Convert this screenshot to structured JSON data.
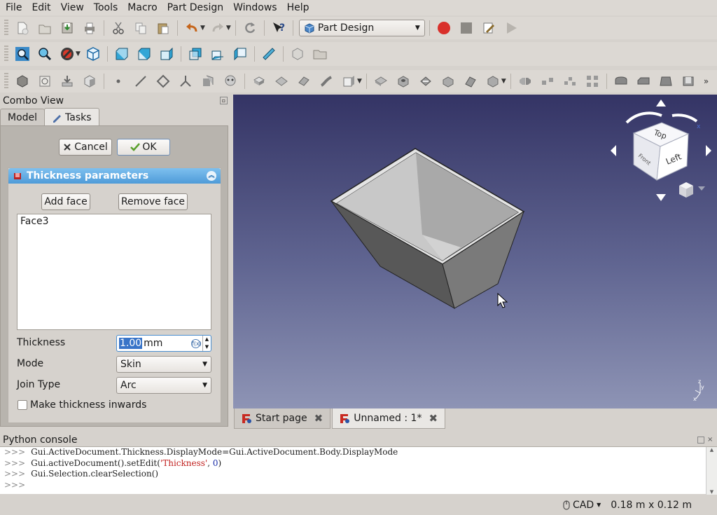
{
  "menubar": {
    "items": [
      {
        "label": "File",
        "name": "menu-file"
      },
      {
        "label": "Edit",
        "name": "menu-edit"
      },
      {
        "label": "View",
        "name": "menu-view"
      },
      {
        "label": "Tools",
        "name": "menu-tools"
      },
      {
        "label": "Macro",
        "name": "menu-macro"
      },
      {
        "label": "Part Design",
        "name": "menu-part-design"
      },
      {
        "label": "Windows",
        "name": "menu-windows"
      },
      {
        "label": "Help",
        "name": "menu-help"
      }
    ]
  },
  "toolbar": {
    "workbench": "Part Design"
  },
  "combo_view": {
    "title": "Combo View",
    "tabs": {
      "model": "Model",
      "tasks": "Tasks"
    },
    "cancel_label": "Cancel",
    "ok_label": "OK"
  },
  "thickness": {
    "header": "Thickness parameters",
    "add_face_label": "Add face",
    "remove_face_label": "Remove face",
    "faces": [
      "Face3"
    ],
    "thickness_label": "Thickness",
    "thickness_value": "1.00",
    "thickness_unit": "mm",
    "mode_label": "Mode",
    "mode_value": "Skin",
    "join_label": "Join Type",
    "join_value": "Arc",
    "inwards_label": "Make thickness inwards",
    "inwards_checked": false
  },
  "viewport": {
    "navcube_top": "Top",
    "navcube_left": "Left",
    "navcube_front": "Front"
  },
  "doc_tabs": {
    "start": "Start page",
    "unnamed": "Unnamed : 1*"
  },
  "python_console": {
    "title": "Python console",
    "prompt": ">>>",
    "lines": [
      {
        "code": "Gui.ActiveDocument.Thickness.DisplayMode=Gui.ActiveDocument.Body.DisplayMode"
      },
      {
        "pre": "Gui.activeDocument().setEdit(",
        "str": "'Thickness'",
        "mid": ", ",
        "num": "0",
        "post": ")"
      },
      {
        "code": "Gui.Selection.clearSelection()"
      }
    ]
  },
  "status": {
    "navigation": "CAD",
    "dimensions": "0.18 m x 0.12 m"
  },
  "colors": {
    "viewport_top": "#343465",
    "viewport_bottom": "#8e94b5",
    "panel_header": "#5aa6df",
    "record_red": "#d9302b"
  }
}
